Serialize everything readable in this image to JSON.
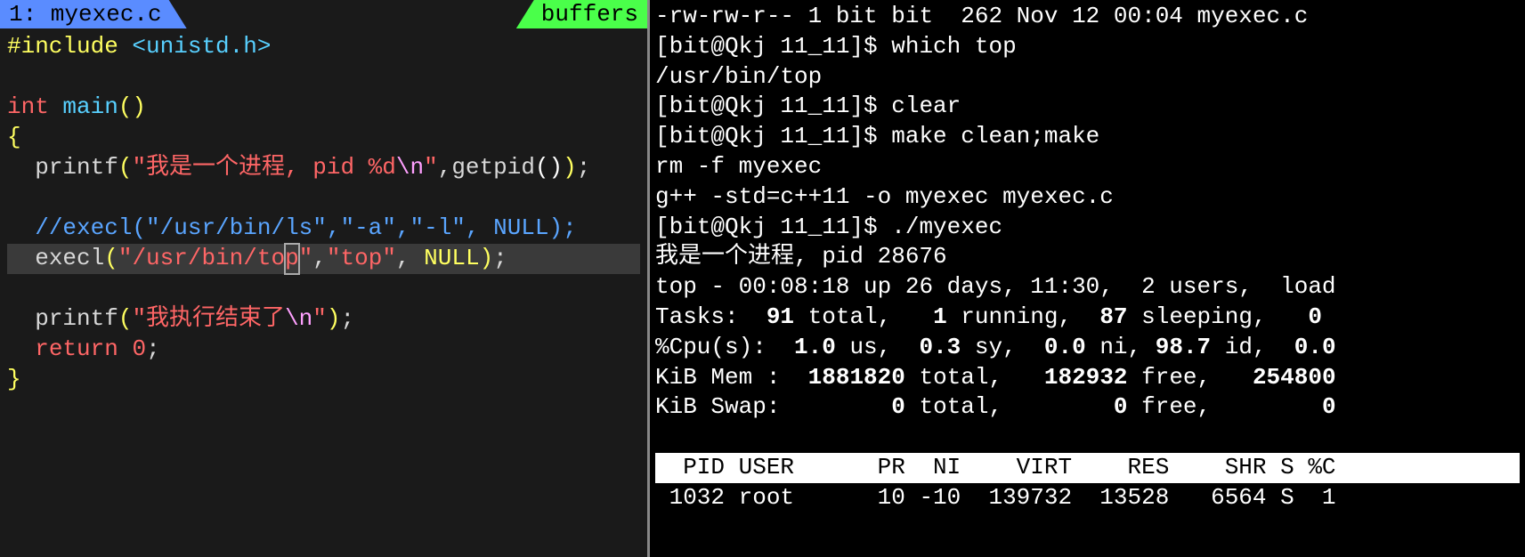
{
  "editor": {
    "tab_label": " 1: myexec.c ",
    "buffers_label": " buffers ",
    "include_directive": "#include",
    "include_header": " <unistd.h>",
    "int_kw": "int",
    "main_fn": " main",
    "printf_fn": "printf",
    "str1_a": "\"我是一个进程, pid %d",
    "str1_esc": "\\n",
    "str1_b": "\"",
    "getpid": "getpid",
    "comment_line": "//execl(\"/usr/bin/ls\",\"-a\",\"-l\", NULL);",
    "execl_fn": "execl",
    "str_top_path_a": "\"/usr/bin/to",
    "cursor_char": "p",
    "str_top_path_b": "\"",
    "str_top": "\"top\"",
    "null_kw": "NULL",
    "str2_a": "\"我执行结束了",
    "str2_esc": "\\n",
    "str2_b": "\"",
    "return_kw": "return",
    "zero": "0"
  },
  "terminal": {
    "ls_line": "-rw-rw-r-- 1 bit bit  262 Nov 12 00:04 myexec.c",
    "prompt1": "[bit@Qkj 11_11]$ which top",
    "which_out": "/usr/bin/top",
    "prompt2": "[bit@Qkj 11_11]$ clear",
    "prompt3": "[bit@Qkj 11_11]$ make clean;make",
    "make_line1": "rm -f myexec",
    "make_line2": "g++ -std=c++11 -o myexec myexec.c",
    "prompt4": "[bit@Qkj 11_11]$ ./myexec",
    "prog_out": "我是一个进程, pid 28676",
    "top_header": "top - 00:08:18 up 26 days, 11:30,  2 users,  load",
    "top_tasks_a": "Tasks:  ",
    "top_tasks_b": "91 ",
    "top_tasks_c": "total,   ",
    "top_tasks_d": "1 ",
    "top_tasks_e": "running,  ",
    "top_tasks_f": "87 ",
    "top_tasks_g": "sleeping,   ",
    "top_tasks_h": "0",
    "top_cpu_a": "%Cpu(s):  ",
    "top_cpu_b": "1.0 ",
    "top_cpu_c": "us,  ",
    "top_cpu_d": "0.3 ",
    "top_cpu_e": "sy,  ",
    "top_cpu_f": "0.0 ",
    "top_cpu_g": "ni, ",
    "top_cpu_h": "98.7 ",
    "top_cpu_i": "id,  ",
    "top_cpu_j": "0.0",
    "top_mem_a": "KiB Mem :  ",
    "top_mem_b": "1881820 ",
    "top_mem_c": "total,   ",
    "top_mem_d": "182932 ",
    "top_mem_e": "free,   ",
    "top_mem_f": "254800",
    "top_swap_a": "KiB Swap:        ",
    "top_swap_b": "0 ",
    "top_swap_c": "total,        ",
    "top_swap_d": "0 ",
    "top_swap_e": "free,        ",
    "top_swap_f": "0",
    "top_cols": "  PID USER      PR  NI    VIRT    RES    SHR S %C",
    "top_row1": " 1032 root      10 -10  139732  13528   6564 S  1"
  }
}
